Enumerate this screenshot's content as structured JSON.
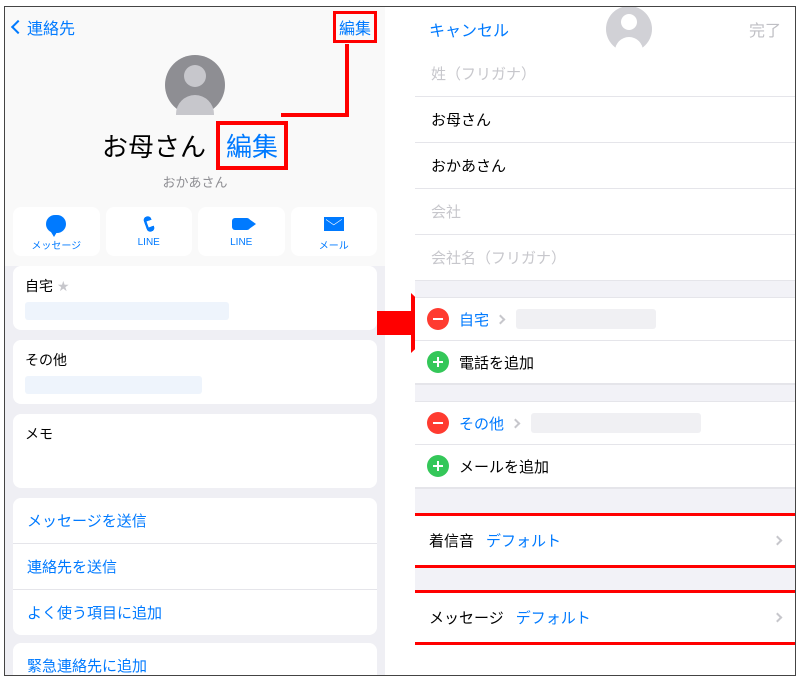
{
  "left": {
    "back_label": "連絡先",
    "edit_label": "編集",
    "edit_label_large": "編集",
    "contact_name": "お母さん",
    "furigana": "おかあさん",
    "actions": [
      {
        "label": "メッセージ"
      },
      {
        "label": "LINE"
      },
      {
        "label": "LINE"
      },
      {
        "label": "メール"
      }
    ],
    "home_label": "自宅",
    "other_label": "その他",
    "memo_label": "メモ",
    "menu": {
      "send_message": "メッセージを送信",
      "send_contact": "連絡先を送信",
      "add_favorite": "よく使う項目に追加",
      "add_emergency": "緊急連絡先に追加"
    }
  },
  "right": {
    "cancel_label": "キャンセル",
    "done_label": "完了",
    "fields": {
      "lastname_furigana_ph": "姓（フリガナ）",
      "firstname_value": "お母さん",
      "firstname_furigana_value": "おかあさん",
      "company_ph": "会社",
      "company_furigana_ph": "会社名（フリガナ）"
    },
    "phone": {
      "home_label": "自宅",
      "add_label": "電話を追加"
    },
    "email": {
      "other_label": "その他",
      "add_label": "メールを追加"
    },
    "ringtone": {
      "label": "着信音",
      "value": "デフォルト"
    },
    "texttone": {
      "label": "メッセージ",
      "value": "デフォルト"
    }
  }
}
